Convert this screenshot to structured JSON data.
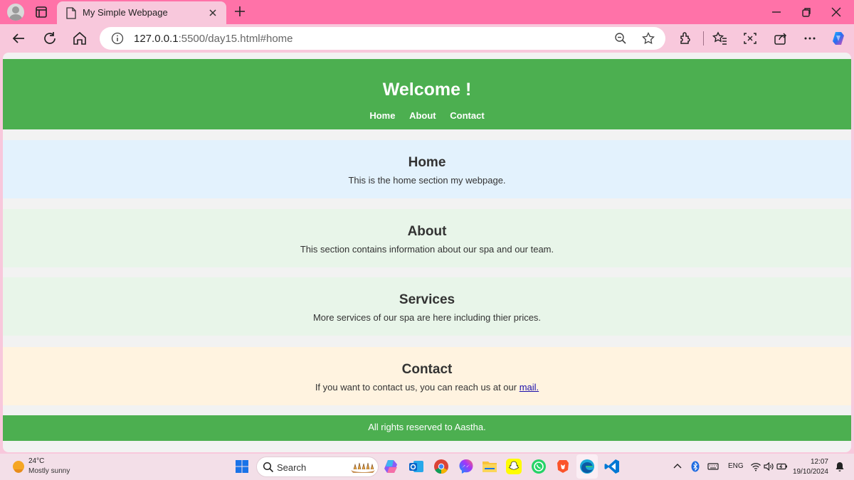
{
  "browser": {
    "tab_title": "My Simple Webpage",
    "url_host": "127.0.0.1",
    "url_rest": ":5500/day15.html#home"
  },
  "page": {
    "header_title": "Welcome !",
    "nav": [
      "Home",
      "About",
      "Contact"
    ],
    "sections": [
      {
        "title": "Home",
        "text": "This is the home section my webpage.",
        "bg": "#e3f2fd"
      },
      {
        "title": "About",
        "text": "This section contains information about our spa and our team.",
        "bg": "#e8f5e9"
      },
      {
        "title": "Services",
        "text": "More services of our spa are here including thier prices.",
        "bg": "#e8f5e9"
      },
      {
        "title": "Contact",
        "text_before": "If you want to contact us, you can reach us at our",
        "link": "mail.",
        "bg": "#fff3e0"
      }
    ],
    "footer": "All rights reserved to Aastha.",
    "accent": "#4caf50"
  },
  "taskbar": {
    "weather_temp": "24°C",
    "weather_desc": "Mostly sunny",
    "search": "Search",
    "lang": "ENG",
    "time": "12:07",
    "date": "19/10/2024"
  }
}
